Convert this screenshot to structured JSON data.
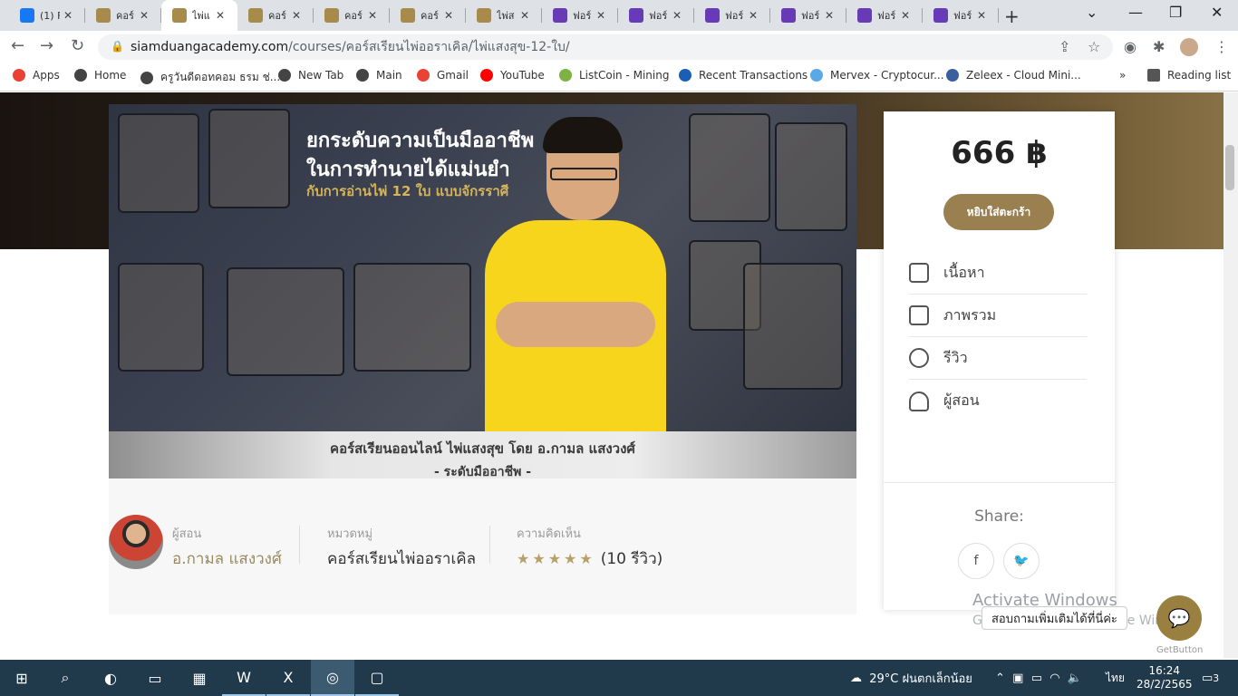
{
  "browser": {
    "tabs": [
      {
        "title": "(1) F",
        "favicon": "facebook",
        "color": "#1877f2"
      },
      {
        "title": "คอร์",
        "favicon": "siamduang",
        "color": "#a88a4a"
      },
      {
        "title": "ไพ่แ",
        "favicon": "siamduang",
        "color": "#a88a4a",
        "active": true
      },
      {
        "title": "คอร์",
        "favicon": "siamduang",
        "color": "#a88a4a"
      },
      {
        "title": "คอร์",
        "favicon": "siamduang",
        "color": "#a88a4a"
      },
      {
        "title": "คอร์",
        "favicon": "siamduang",
        "color": "#a88a4a"
      },
      {
        "title": "ไพ่ส",
        "favicon": "siamduang",
        "color": "#a88a4a"
      },
      {
        "title": "ฟอร์",
        "favicon": "form",
        "color": "#673ab7"
      },
      {
        "title": "ฟอร์",
        "favicon": "form",
        "color": "#673ab7"
      },
      {
        "title": "ฟอร์",
        "favicon": "form",
        "color": "#673ab7"
      },
      {
        "title": "ฟอร์",
        "favicon": "form",
        "color": "#673ab7"
      },
      {
        "title": "ฟอร์",
        "favicon": "form",
        "color": "#673ab7"
      },
      {
        "title": "ฟอร์",
        "favicon": "form",
        "color": "#673ab7"
      }
    ],
    "url_host": "siamduangacademy.com",
    "url_path": "/courses/คอร์สเรียนไพ่ออราเคิล/ไพ่แสงสุข-12-ใบ/",
    "bookmarks": [
      {
        "label": "Apps",
        "icon": "apps-grid",
        "color": "#e94235"
      },
      {
        "label": "Home",
        "icon": "globe",
        "color": "#444"
      },
      {
        "label": "ครูวันดีดอทคอม ธรม ช่...",
        "icon": "globe",
        "color": "#444"
      },
      {
        "label": "New Tab",
        "icon": "globe",
        "color": "#444"
      },
      {
        "label": "Main",
        "icon": "globe",
        "color": "#444"
      },
      {
        "label": "Gmail",
        "icon": "gmail",
        "color": "#ea4335"
      },
      {
        "label": "YouTube",
        "icon": "youtube",
        "color": "#ff0000"
      },
      {
        "label": "ListCoin - Mining",
        "icon": "listcoin",
        "color": "#7cb342"
      },
      {
        "label": "Recent Transactions",
        "icon": "coin",
        "color": "#1a5fb4"
      },
      {
        "label": "Mervex - Cryptocur...",
        "icon": "mervex",
        "color": "#5aa9e6"
      },
      {
        "label": "Zeleex - Cloud Mini...",
        "icon": "zeleex",
        "color": "#3a5fa0"
      }
    ],
    "reading_list": "Reading list"
  },
  "banner": {
    "headline1": "ยกระดับความเป็นมืออาชีพ",
    "headline2": "ในการทำนายได้แม่นยำ",
    "headline3": "กับการอ่านไพ่ 12 ใบ แบบจักรราศี",
    "caption1": "คอร์สเรียนออนไลน์ ไพ่แสงสุข โดย อ.กามล แสงวงศ์",
    "caption2": "- ระดับมืออาชีพ -"
  },
  "course_meta": {
    "instructor_label": "ผู้สอน",
    "instructor_name": "อ.กามล แสงวงศ์",
    "category_label": "หมวดหมู่",
    "category_value": "คอร์สเรียนไพ่ออราเคิล",
    "reviews_label": "ความคิดเห็น",
    "rating": 5,
    "reviews_count": "(10 รีวิว)"
  },
  "sidebar": {
    "price": "666 ฿",
    "cart_button": "หยิบใส่ตะกร้า",
    "items": [
      {
        "label": "เนื้อหา",
        "icon": "tag-icon"
      },
      {
        "label": "ภาพรวม",
        "icon": "document-icon"
      },
      {
        "label": "รีวิว",
        "icon": "chat-icon"
      },
      {
        "label": "ผู้สอน",
        "icon": "user-icon"
      }
    ],
    "share_label": "Share:"
  },
  "overlay": {
    "activate_title": "Activate Windows",
    "activate_sub": "Go to Settings to activate Windows.",
    "chat_bubble": "สอบถามเพิ่มเติมได้ที่นี่ค่ะ",
    "get_button": "GetButton"
  },
  "taskbar": {
    "weather": "29°C ฝนตกเล็กน้อย",
    "lang": "ไทย",
    "time": "16:24",
    "date": "28/2/2565",
    "notifications": "3"
  }
}
